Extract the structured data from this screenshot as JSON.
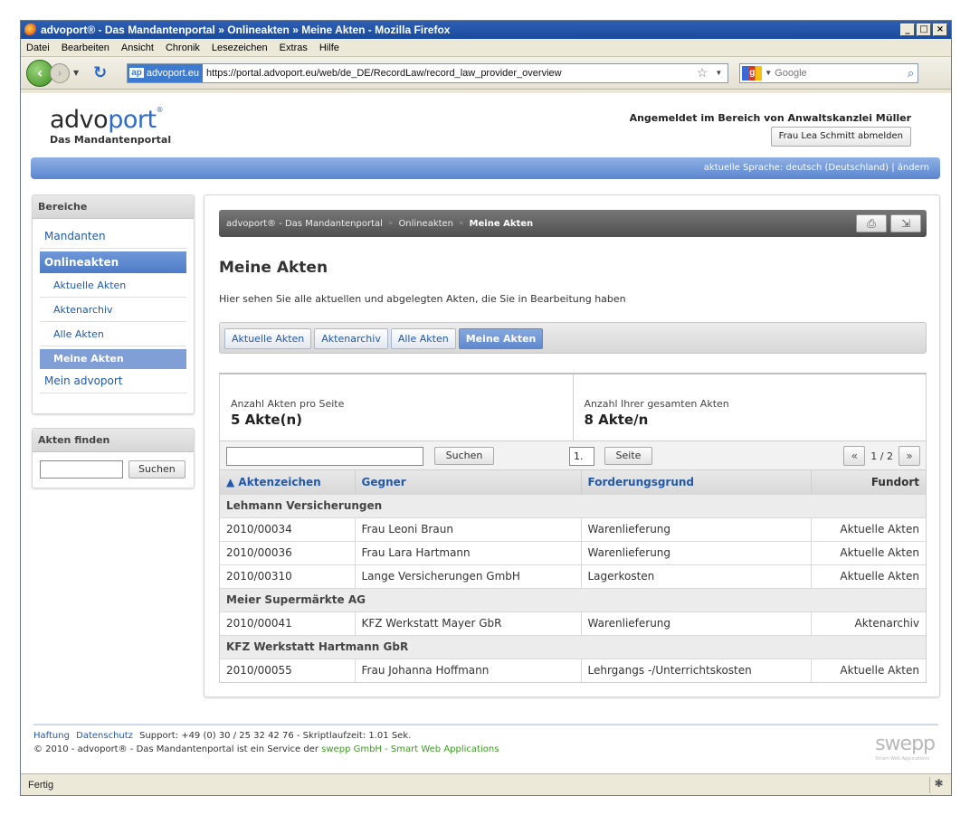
{
  "window": {
    "title": "advoport® - Das Mandantenportal » Onlineakten » Meine Akten - Mozilla Firefox",
    "menu": [
      "Datei",
      "Bearbeiten",
      "Ansicht",
      "Chronik",
      "Lesezeichen",
      "Extras",
      "Hilfe"
    ],
    "url_site": "advoport.eu",
    "url_site_badge": "ap",
    "url": "https://portal.advoport.eu/web/de_DE/RecordLaw/record_law_provider_overview",
    "search_placeholder": "Google",
    "status": "Fertig"
  },
  "header": {
    "brand_a": "advo",
    "brand_b": "port",
    "brand_reg": "®",
    "brand_sub": "Das Mandantenportal",
    "login_text": "Angemeldet im Bereich von Anwaltskanzlei Müller",
    "logout_label": "Frau Lea Schmitt abmelden",
    "language_text": "aktuelle Sprache: deutsch (Deutschland) | ändern"
  },
  "sidebar": {
    "title": "Bereiche",
    "items": [
      {
        "label": "Mandanten"
      },
      {
        "label": "Onlineakten"
      },
      {
        "label": "Aktuelle Akten"
      },
      {
        "label": "Aktenarchiv"
      },
      {
        "label": "Alle Akten"
      },
      {
        "label": "Meine Akten"
      },
      {
        "label": "Mein advoport"
      }
    ],
    "find_title": "Akten finden",
    "find_button": "Suchen"
  },
  "main": {
    "breadcrumb": [
      "advoport® - Das Mandantenportal",
      "Onlineakten",
      "Meine Akten"
    ],
    "title": "Meine Akten",
    "description": "Hier sehen Sie alle aktuellen und abgelegten Akten, die Sie in Bearbeitung haben",
    "tabs": [
      "Aktuelle Akten",
      "Aktenarchiv",
      "Alle Akten",
      "Meine Akten"
    ],
    "stats": {
      "per_page_label": "Anzahl Akten pro Seite",
      "per_page_value": "5 Akte(n)",
      "total_label": "Anzahl Ihrer gesamten Akten",
      "total_value": "8 Akte/n"
    },
    "search_button": "Suchen",
    "page_input": "1.",
    "page_button": "Seite",
    "pager_text": "1 / 2",
    "columns": [
      "▲ Aktenzeichen",
      "Gegner",
      "Forderungsgrund",
      "Fundort"
    ],
    "groups": [
      {
        "name": "Lehmann Versicherungen",
        "rows": [
          [
            "2010/00034",
            "Frau Leoni Braun",
            "Warenlieferung",
            "Aktuelle Akten"
          ],
          [
            "2010/00036",
            "Frau Lara Hartmann",
            "Warenlieferung",
            "Aktuelle Akten"
          ],
          [
            "2010/00310",
            "Lange Versicherungen GmbH",
            "Lagerkosten",
            "Aktuelle Akten"
          ]
        ]
      },
      {
        "name": "Meier Supermärkte AG",
        "rows": [
          [
            "2010/00041",
            "KFZ Werkstatt Mayer GbR",
            "Warenlieferung",
            "Aktenarchiv"
          ]
        ]
      },
      {
        "name": "KFZ Werkstatt Hartmann GbR",
        "rows": [
          [
            "2010/00055",
            "Frau Johanna Hoffmann",
            "Lehrgangs -/Unterrichtskosten",
            "Aktuelle Akten"
          ]
        ]
      }
    ]
  },
  "footer": {
    "link1": "Haftung",
    "link2": "Datenschutz",
    "support": "Support: +49 (0) 30 / 25 32 42 76 - Skriptlaufzeit: 1.01 Sek.",
    "copyright": "© 2010 - advoport® - Das Mandantenportal ist ein Service der",
    "company": "swepp GmbH - Smart Web Applications",
    "logo": "swepp",
    "logo_sub": "Smart Web Applications"
  }
}
